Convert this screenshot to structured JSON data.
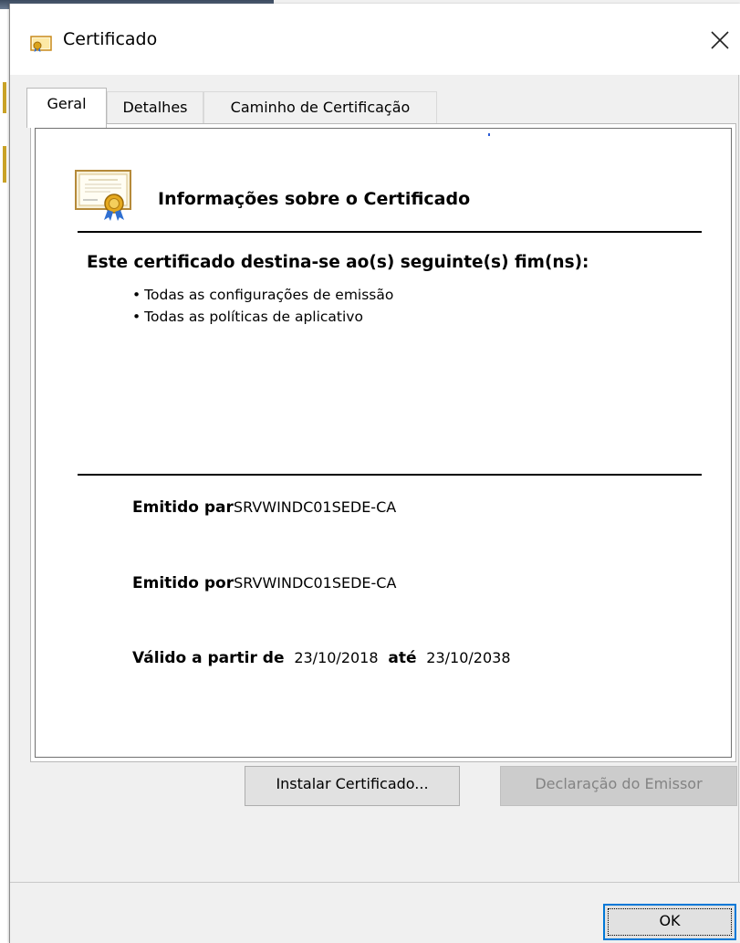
{
  "window": {
    "title": "Certificado",
    "close_glyph": "✕"
  },
  "tabs": [
    {
      "label": "Geral",
      "active": true
    },
    {
      "label": "Detalhes",
      "active": false
    },
    {
      "label": "Caminho de Certificação",
      "active": false
    }
  ],
  "general": {
    "info_heading": "Informações sobre o Certificado",
    "purpose_heading": "Este certificado destina-se ao(s) seguinte(s) fim(ns):",
    "purposes": [
      "Todas as configurações de emissão",
      "Todas as políticas de aplicativo"
    ],
    "issued_to_label": "Emitido par",
    "issued_to_value": "SRVWINDC01SEDE-CA",
    "issued_by_label": "Emitido por",
    "issued_by_value": "SRVWINDC01SEDE-CA",
    "valid_from_label": "Válido a partir de",
    "valid_from_value": "23/10/2018",
    "valid_to_label": "até",
    "valid_to_value": "23/10/2038"
  },
  "buttons": {
    "install_label": "Instalar Certificado...",
    "issuer_statement_label": "Declaração do Emissor",
    "ok_label": "OK"
  },
  "icons": {
    "title_icon": "certificate-icon",
    "info_icon": "certificate-icon",
    "close_icon": "close-icon"
  },
  "colors": {
    "focus_border": "#0078d7",
    "disabled_text": "#838383",
    "ribbon_gold": "#d9a21b",
    "ribbon_blue": "#2f6fd1"
  }
}
